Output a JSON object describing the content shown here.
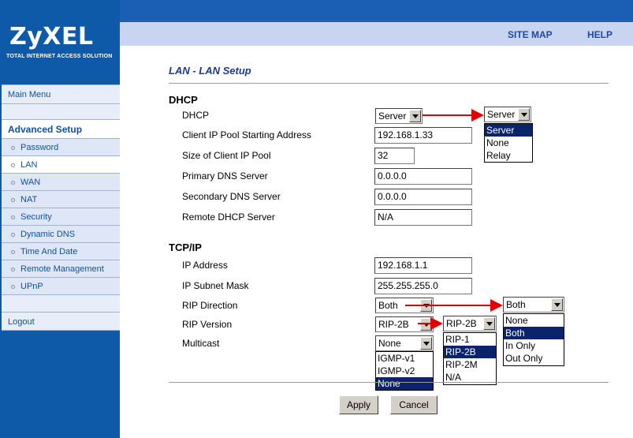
{
  "brand": {
    "name": "ZyXEL",
    "tagline": "TOTAL INTERNET ACCESS SOLUTION"
  },
  "header": {
    "site_map": "SITE MAP",
    "help": "HELP"
  },
  "sidebar": {
    "main_menu": "Main Menu",
    "section": "Advanced Setup",
    "items": [
      {
        "label": "Password"
      },
      {
        "label": "LAN"
      },
      {
        "label": "WAN"
      },
      {
        "label": "NAT"
      },
      {
        "label": "Security"
      },
      {
        "label": "Dynamic DNS"
      },
      {
        "label": "Time And Date"
      },
      {
        "label": "Remote Management"
      },
      {
        "label": "UPnP"
      }
    ],
    "logout": "Logout"
  },
  "page": {
    "title": "LAN - LAN Setup"
  },
  "dhcp": {
    "heading": "DHCP",
    "dhcp_label": "DHCP",
    "dhcp_value": "Server",
    "pool_start_label": "Client IP Pool Starting Address",
    "pool_start_value": "192.168.1.33",
    "pool_size_label": "Size of Client IP Pool",
    "pool_size_value": "32",
    "primary_dns_label": "Primary DNS Server",
    "primary_dns_value": "0.0.0.0",
    "secondary_dns_label": "Secondary DNS Server",
    "secondary_dns_value": "0.0.0.0",
    "remote_dhcp_label": "Remote DHCP Server",
    "remote_dhcp_value": "N/A",
    "dropdown_selected": "Server",
    "options": [
      "Server",
      "None",
      "Relay"
    ]
  },
  "tcpip": {
    "heading": "TCP/IP",
    "ip_label": "IP Address",
    "ip_value": "192.168.1.1",
    "mask_label": "IP Subnet Mask",
    "mask_value": "255.255.255.0",
    "rip_dir_label": "RIP Direction",
    "rip_dir_value": "Both",
    "rip_dir_dropdown_selected": "Both",
    "rip_dir_options": [
      "None",
      "Both",
      "In Only",
      "Out Only"
    ],
    "rip_ver_label": "RIP Version",
    "rip_ver_value": "RIP-2B",
    "rip_ver_dropdown_selected": "RIP-2B",
    "rip_ver_options": [
      "RIP-1",
      "RIP-2B",
      "RIP-2M",
      "N/A"
    ],
    "multicast_label": "Multicast",
    "multicast_value": "None",
    "multicast_options": [
      "IGMP-v1",
      "IGMP-v2",
      "None"
    ]
  },
  "buttons": {
    "apply": "Apply",
    "cancel": "Cancel"
  },
  "colors": {
    "brand_blue": "#0e5aa8",
    "link_blue": "#1d4ba0",
    "highlight": "#0a246a",
    "annotation_arrow": "#e00000"
  }
}
